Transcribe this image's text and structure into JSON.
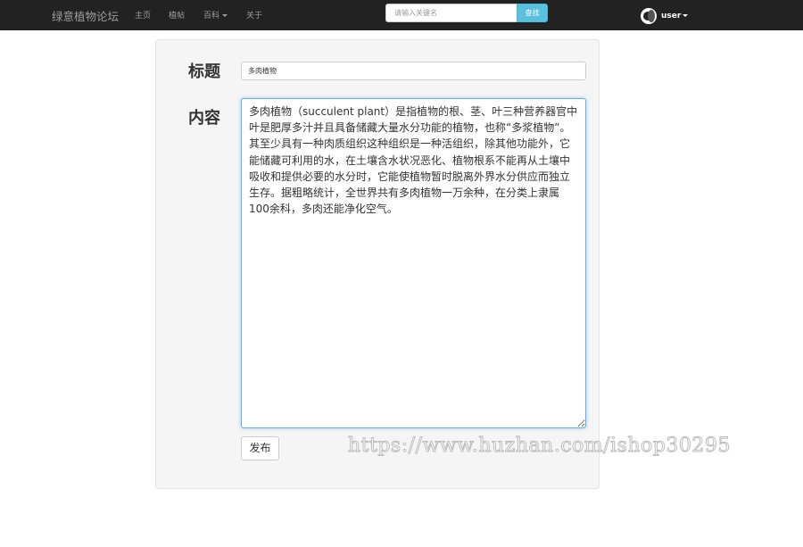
{
  "navbar": {
    "brand": "绿意植物论坛",
    "links": [
      "主页",
      "植帖",
      "百科",
      "关于"
    ],
    "search": {
      "placeholder": "请输入关键名",
      "button_label": "查找"
    },
    "user": {
      "label": "user"
    }
  },
  "form": {
    "title_label": "标题",
    "title_value": "多肉植物",
    "content_label": "内容",
    "content_value": "多肉植物（succulent plant）是指植物的根、茎、叶三种营养器官中叶是肥厚多汁并且具备储藏大量水分功能的植物，也称“多浆植物”。其至少具有一种肉质组织这种组织是一种活组织，除其他功能外，它能储藏可利用的水，在土壤含水状况恶化、植物根系不能再从土壤中吸收和提供必要的水分时，它能使植物暂时脱离外界水分供应而独立生存。据粗略统计，全世界共有多肉植物一万余种，在分类上隶属100余科，多肉还能净化空气。",
    "publish_label": "发布"
  },
  "watermark": "https://www.huzhan.com/ishop30295",
  "colors": {
    "navbar_bg": "#222222",
    "search_button": "#5bc0de",
    "focus_border": "#66afe9",
    "panel_bg": "#f5f5f5"
  }
}
